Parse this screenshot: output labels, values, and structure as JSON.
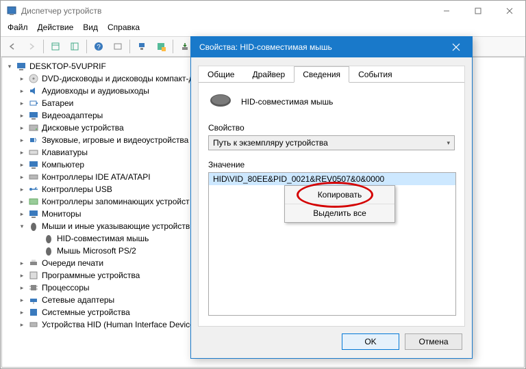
{
  "main": {
    "title": "Диспетчер устройств",
    "menu": [
      "Файл",
      "Действие",
      "Вид",
      "Справка"
    ]
  },
  "tree": {
    "root": "DESKTOP-5VUPRIF",
    "items": [
      "DVD-дисководы и дисководы компакт-д",
      "Аудиовходы и аудиовыходы",
      "Батареи",
      "Видеоадаптеры",
      "Дисковые устройства",
      "Звуковые, игровые и видеоустройства",
      "Клавиатуры",
      "Компьютер",
      "Контроллеры IDE ATA/ATAPI",
      "Контроллеры USB",
      "Контроллеры запоминающих устройст",
      "Мониторы",
      "Мыши и иные указывающие устройств",
      "Очереди печати",
      "Программные устройства",
      "Процессоры",
      "Сетевые адаптеры",
      "Системные устройства",
      "Устройства HID (Human Interface Device"
    ],
    "mouse_children": [
      "HID-совместимая мышь",
      "Мышь Microsoft PS/2"
    ]
  },
  "props": {
    "title": "Свойства: HID-совместимая мышь",
    "tabs": [
      "Общие",
      "Драйвер",
      "Сведения",
      "События"
    ],
    "device_name": "HID-совместимая мышь",
    "prop_label": "Свойство",
    "prop_selected": "Путь к экземпляру устройства",
    "value_label": "Значение",
    "value_row": "HID\\VID_80EE&PID_0021&REV0507&0&0000",
    "ctx": [
      "Копировать",
      "Выделить все"
    ],
    "ok": "OK",
    "cancel": "Отмена"
  },
  "colors": {
    "accent": "#1979ca",
    "highlight": "#d40000"
  }
}
